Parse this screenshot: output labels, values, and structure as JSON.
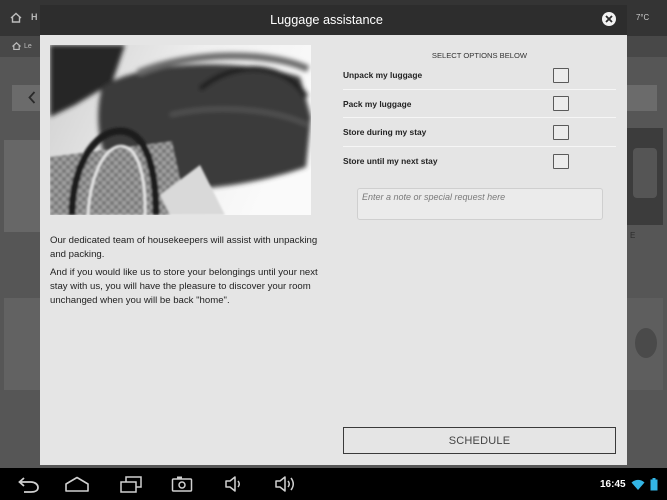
{
  "background": {
    "top_bar_label": "H",
    "temperature": "7°C",
    "breadcrumb_label": "Le",
    "tile_caption": "E"
  },
  "dialog": {
    "title": "Luggage assistance",
    "close_icon": "close-icon",
    "paragraphs": [
      "Our dedicated team of housekeepers will assist with unpacking and packing.",
      "And if you would like us to store your belongings until your next stay with us, you will have the pleasure to discover your room unchanged when you will be back \"home\"."
    ],
    "options_heading": "SELECT OPTIONS BELOW",
    "options": [
      {
        "label": "Unpack my luggage",
        "checked": false
      },
      {
        "label": "Pack my luggage",
        "checked": false
      },
      {
        "label": "Store during my stay",
        "checked": false
      },
      {
        "label": "Store until my next stay",
        "checked": false
      }
    ],
    "note_field": {
      "placeholder": "Enter a note or special request here",
      "value": ""
    },
    "schedule_label": "SCHEDULE"
  },
  "system_bar": {
    "time": "16:45",
    "nav_icons": [
      "back-icon",
      "home-icon",
      "recent-apps-icon",
      "screenshot-icon",
      "volume-down-icon",
      "volume-up-icon"
    ],
    "status_icons": [
      "wifi-icon",
      "battery-icon"
    ]
  },
  "colors": {
    "dialog_header": "#2d2d2d",
    "dialog_body": "#e5e5e5",
    "status_accent": "#33b5e5"
  }
}
